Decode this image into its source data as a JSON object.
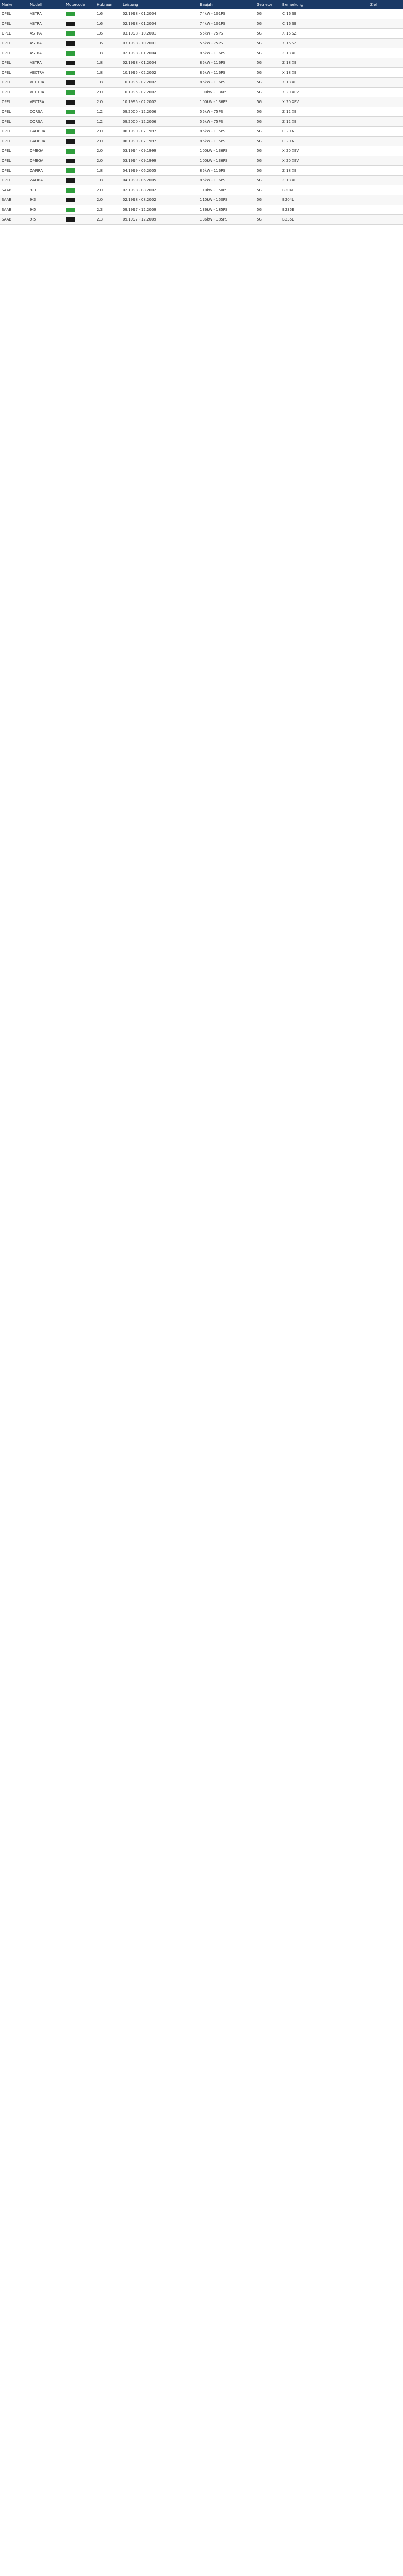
{
  "headers": [
    "Marke",
    "Modell",
    "Motorcode",
    "Hubraum",
    "Leistung",
    "Baujahr",
    "Getriebe",
    "Bemerkung",
    "Ziel"
  ],
  "rows": [
    {
      "brand": "OPEL",
      "model": "ASTRA",
      "badge": "green",
      "engine": "1.6",
      "period": "02.1998 - 01.2004",
      "power": "74kW - 101PS",
      "gear": "5G",
      "note": "C 16 SE"
    },
    {
      "brand": "OPEL",
      "model": "ASTRA",
      "badge": "black",
      "engine": "1.6",
      "period": "02.1998 - 01.2004",
      "power": "74kW - 101PS",
      "gear": "5G",
      "note": "C 16 SE"
    },
    {
      "brand": "OPEL",
      "model": "ASTRA",
      "badge": "green",
      "engine": "1.6",
      "period": "03.1998 - 10.2001",
      "power": "55kW - 75PS",
      "gear": "5G",
      "note": "X 16 SZ"
    },
    {
      "brand": "OPEL",
      "model": "ASTRA",
      "badge": "black",
      "engine": "1.6",
      "period": "03.1998 - 10.2001",
      "power": "55kW - 75PS",
      "gear": "5G",
      "note": "X 16 SZ"
    },
    {
      "brand": "OPEL",
      "model": "ASTRA",
      "badge": "green",
      "engine": "1.8",
      "period": "02.1998 - 01.2004",
      "power": "85kW - 116PS",
      "gear": "5G",
      "note": "Z 18 XE"
    },
    {
      "brand": "OPEL",
      "model": "ASTRA",
      "badge": "black",
      "engine": "1.8",
      "period": "02.1998 - 01.2004",
      "power": "85kW - 116PS",
      "gear": "5G",
      "note": "Z 18 XE"
    },
    {
      "brand": "OPEL",
      "model": "VECTRA",
      "badge": "green",
      "engine": "1.8",
      "period": "10.1995 - 02.2002",
      "power": "85kW - 116PS",
      "gear": "5G",
      "note": "X 18 XE"
    },
    {
      "brand": "OPEL",
      "model": "VECTRA",
      "badge": "black",
      "engine": "1.8",
      "period": "10.1995 - 02.2002",
      "power": "85kW - 116PS",
      "gear": "5G",
      "note": "X 18 XE"
    },
    {
      "brand": "OPEL",
      "model": "VECTRA",
      "badge": "green",
      "engine": "2.0",
      "period": "10.1995 - 02.2002",
      "power": "100kW - 136PS",
      "gear": "5G",
      "note": "X 20 XEV"
    },
    {
      "brand": "OPEL",
      "model": "VECTRA",
      "badge": "black",
      "engine": "2.0",
      "period": "10.1995 - 02.2002",
      "power": "100kW - 136PS",
      "gear": "5G",
      "note": "X 20 XEV"
    },
    {
      "brand": "OPEL",
      "model": "CORSA",
      "badge": "green",
      "engine": "1.2",
      "period": "09.2000 - 12.2006",
      "power": "55kW - 75PS",
      "gear": "5G",
      "note": "Z 12 XE"
    },
    {
      "brand": "OPEL",
      "model": "CORSA",
      "badge": "black",
      "engine": "1.2",
      "period": "09.2000 - 12.2006",
      "power": "55kW - 75PS",
      "gear": "5G",
      "note": "Z 12 XE"
    },
    {
      "brand": "OPEL",
      "model": "CALIBRA",
      "badge": "green",
      "engine": "2.0",
      "period": "06.1990 - 07.1997",
      "power": "85kW - 115PS",
      "gear": "5G",
      "note": "C 20 NE"
    },
    {
      "brand": "OPEL",
      "model": "CALIBRA",
      "badge": "black",
      "engine": "2.0",
      "period": "06.1990 - 07.1997",
      "power": "85kW - 115PS",
      "gear": "5G",
      "note": "C 20 NE"
    },
    {
      "brand": "OPEL",
      "model": "OMEGA",
      "badge": "green",
      "engine": "2.0",
      "period": "03.1994 - 09.1999",
      "power": "100kW - 136PS",
      "gear": "5G",
      "note": "X 20 XEV"
    },
    {
      "brand": "OPEL",
      "model": "OMEGA",
      "badge": "black",
      "engine": "2.0",
      "period": "03.1994 - 09.1999",
      "power": "100kW - 136PS",
      "gear": "5G",
      "note": "X 20 XEV"
    },
    {
      "brand": "OPEL",
      "model": "ZAFIRA",
      "badge": "green",
      "engine": "1.8",
      "period": "04.1999 - 06.2005",
      "power": "85kW - 116PS",
      "gear": "5G",
      "note": "Z 18 XE"
    },
    {
      "brand": "OPEL",
      "model": "ZAFIRA",
      "badge": "black",
      "engine": "1.8",
      "period": "04.1999 - 06.2005",
      "power": "85kW - 116PS",
      "gear": "5G",
      "note": "Z 18 XE"
    },
    {
      "brand": "SAAB",
      "model": "9-3",
      "badge": "green",
      "engine": "2.0",
      "period": "02.1998 - 08.2002",
      "power": "110kW - 150PS",
      "gear": "5G",
      "note": "B204L"
    },
    {
      "brand": "SAAB",
      "model": "9-3",
      "badge": "black",
      "engine": "2.0",
      "period": "02.1998 - 08.2002",
      "power": "110kW - 150PS",
      "gear": "5G",
      "note": "B204L"
    },
    {
      "brand": "SAAB",
      "model": "9-5",
      "badge": "green",
      "engine": "2.3",
      "period": "09.1997 - 12.2009",
      "power": "136kW - 185PS",
      "gear": "5G",
      "note": "B235E"
    },
    {
      "brand": "SAAB",
      "model": "9-5",
      "badge": "black",
      "engine": "2.3",
      "period": "09.1997 - 12.2009",
      "power": "136kW - 185PS",
      "gear": "5G",
      "note": "B235E"
    }
  ]
}
